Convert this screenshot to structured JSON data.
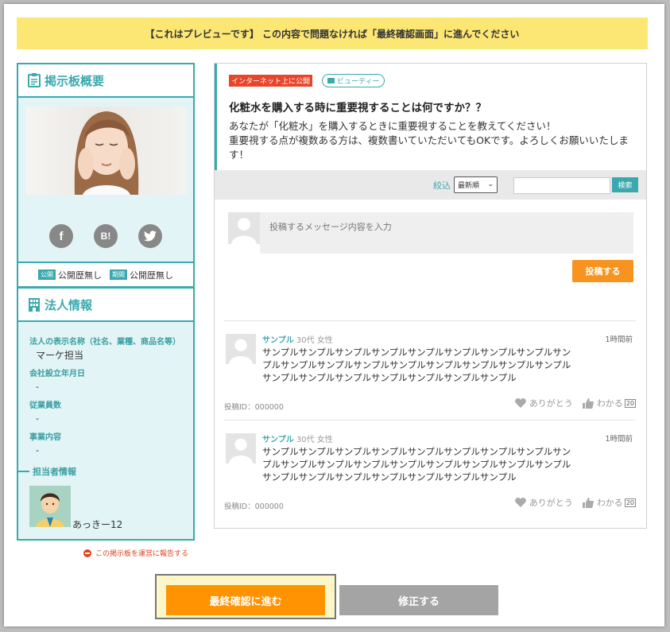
{
  "banner": {
    "text": "【これはプレビューです】 この内容で問題なければ「最終確認画面」に進んでください"
  },
  "overview": {
    "title": "掲示板概要",
    "social": {
      "facebook": "f",
      "hatena": "B!",
      "twitter": "twitter"
    },
    "public_tag": "公開",
    "public_text": "公開歴無し",
    "period_tag": "期間",
    "period_text": "公開歴無し"
  },
  "corp": {
    "title": "法人情報",
    "fields": [
      {
        "label": "法人の表示名称（社名、業種、商品名等）",
        "value": "マーケ担当"
      },
      {
        "label": "会社設立年月日",
        "value": "-"
      },
      {
        "label": "従業員数",
        "value": "-"
      },
      {
        "label": "事業内容",
        "value": "-"
      }
    ],
    "contact_heading": "担当者情報",
    "contact_name": "あっきー12"
  },
  "report_link": "この掲示板を運営に報告する",
  "post": {
    "visibility_badge": "インターネット上に公開",
    "category": "ビューティー",
    "title": "化粧水を購入する時に重要視することは何ですか？？",
    "body_line1": "あなたが「化粧水」を購入するときに重要視することを教えてください！",
    "body_line2": "重要視する点が複数ある方は、複数書いていただいてもOKです。よろしくお願いいたします！"
  },
  "filter": {
    "label": "絞込",
    "sort_value": "最新順",
    "search_button": "検索"
  },
  "composer": {
    "placeholder": "投稿するメッセージ内容を入力",
    "post_button": "投稿する"
  },
  "comments": [
    {
      "user": "サンプル",
      "age": "30代",
      "gender": "女性",
      "time": "1時間前",
      "text": "サンプルサンプルサンプルサンプルサンプルサンプルサンプルサンプルサンプルサンプルサンプルサンプルサンプルサンプルサンプルサンプルサンプルサンプルサンプルサンプルサンプルサンプルサンプルサンプル",
      "post_id": "投稿ID：000000",
      "thanks": "ありがとう",
      "understand": "わかる",
      "count": "20"
    },
    {
      "user": "サンプル",
      "age": "30代",
      "gender": "女性",
      "time": "1時間前",
      "text": "サンプルサンプルサンプルサンプルサンプルサンプルサンプルサンプルサンプルサンプルサンプルサンプルサンプルサンプルサンプルサンプルサンプルサンプルサンプルサンプルサンプルサンプルサンプルサンプル",
      "post_id": "投稿ID：000000",
      "thanks": "ありがとう",
      "understand": "わかる",
      "count": "20"
    }
  ],
  "actions": {
    "proceed": "最終確認に進む",
    "edit": "修正する"
  },
  "colors": {
    "accent": "#3aa9ae",
    "orange": "#ff9302",
    "banner": "#fde774",
    "red": "#e8452b"
  }
}
